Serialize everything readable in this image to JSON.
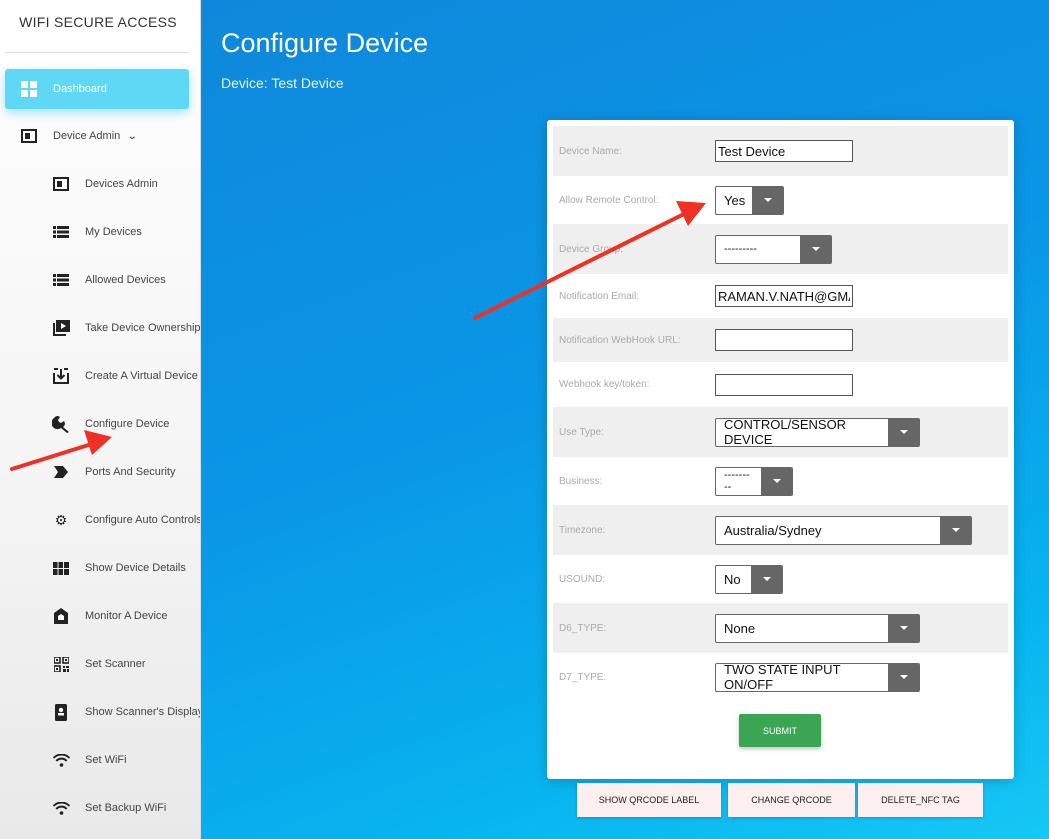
{
  "sidebar": {
    "brand": "WIFI SECURE ACCESS",
    "dashboard": "Dashboard",
    "device_admin": "Device Admin",
    "items": [
      {
        "label": "Devices Admin",
        "icon": "contrast-icon"
      },
      {
        "label": "My Devices",
        "icon": "list-icon"
      },
      {
        "label": "Allowed Devices",
        "icon": "list-icon"
      },
      {
        "label": "Take Device Ownership",
        "icon": "video-library-icon"
      },
      {
        "label": "Create A Virtual Device",
        "icon": "download-box-icon"
      },
      {
        "label": "Configure Device",
        "icon": "wrench-icon"
      },
      {
        "label": "Ports And Security",
        "icon": "label-icon"
      },
      {
        "label": "Configure Auto Controls",
        "icon": "gear-icon"
      },
      {
        "label": "Show Device Details",
        "icon": "grid-icon"
      },
      {
        "label": "Monitor A Device",
        "icon": "home-box-icon"
      },
      {
        "label": "Set Scanner",
        "icon": "qrcode-icon"
      },
      {
        "label": "Show Scanner's Display",
        "icon": "phone-icon"
      },
      {
        "label": "Set WiFi",
        "icon": "wifi-icon"
      },
      {
        "label": "Set Backup WiFi",
        "icon": "wifi-icon"
      }
    ]
  },
  "main": {
    "title": "Configure Device",
    "subtitle": "Device: Test Device"
  },
  "form": {
    "device_name": {
      "label": "Device Name:",
      "value": "Test Device"
    },
    "remote_control": {
      "label": "Allow Remote Control:",
      "value": "Yes"
    },
    "device_group": {
      "label": "Device Group:",
      "value": "---------"
    },
    "notification_email": {
      "label": "Notification Email:",
      "value": "RAMAN.V.NATH@GMA"
    },
    "webhook_url": {
      "label": "Notification WebHook URL:",
      "value": ""
    },
    "webhook_key": {
      "label": "Webhook key/token:",
      "value": ""
    },
    "use_type": {
      "label": "Use Type:",
      "value": "CONTROL/SENSOR DEVICE"
    },
    "business": {
      "label": "Business:",
      "value": "---------"
    },
    "timezone": {
      "label": "Timezone:",
      "value": "Australia/Sydney"
    },
    "usound": {
      "label": "USOUND:",
      "value": "No"
    },
    "d6_type": {
      "label": "D6_TYPE:",
      "value": "None"
    },
    "d7_type": {
      "label": "D7_TYPE:",
      "value": "TWO STATE INPUT ON/OFF"
    },
    "submit": "SUBMIT"
  },
  "actions": {
    "qrcode_label": "SHOW QRCODE LABEL",
    "change_qrcode": "CHANGE QRCODE",
    "delete_nfc": "DELETE_NFC TAG"
  },
  "colors": {
    "accent": "#5fd8f5",
    "submit": "#3aa553",
    "annotation_arrow": "#ee3124"
  }
}
